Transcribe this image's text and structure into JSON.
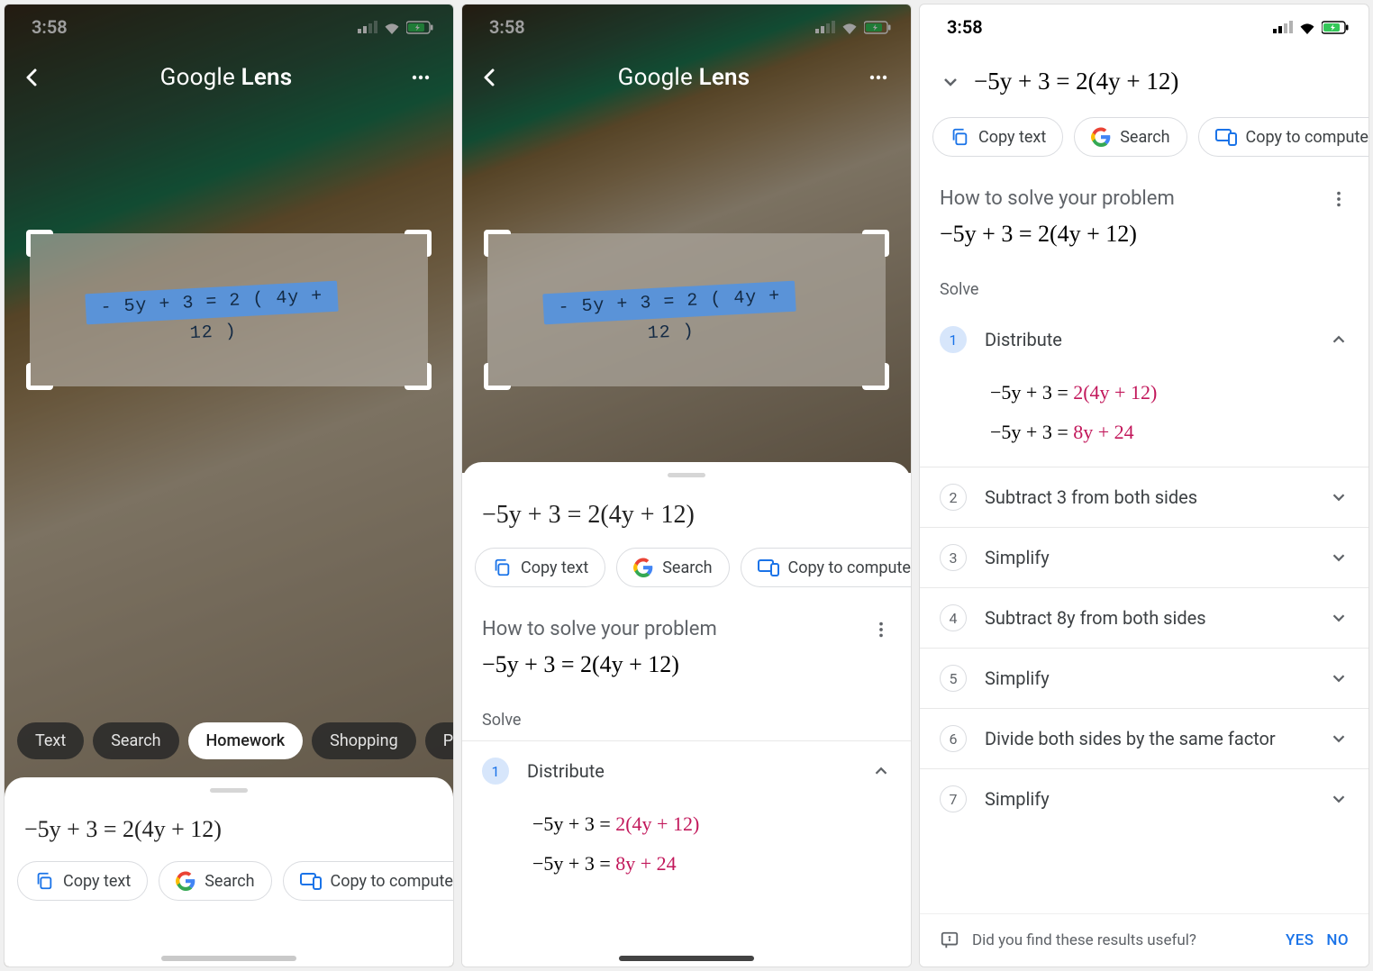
{
  "status": {
    "time": "3:58",
    "carrier_strength": 3
  },
  "lens": {
    "brand_light": "Google",
    "brand_bold": "Lens"
  },
  "handwritten_eq": "- 5y + 3 = 2 ( 4y + 12 )",
  "categories": [
    "Text",
    "Search",
    "Homework",
    "Shopping",
    "Places"
  ],
  "equation": "−5y + 3 = 2(4y + 12)",
  "actions": {
    "copy_text": "Copy text",
    "search": "Search",
    "copy_to_computer": "Copy to computer"
  },
  "solve": {
    "heading": "How to solve your problem",
    "label": "Solve",
    "steps": [
      {
        "n": 1,
        "title": "Distribute",
        "expanded": true,
        "lines": [
          {
            "lhs": "−5y + 3 = ",
            "rhs": "2(4y + 12)"
          },
          {
            "lhs": "−5y + 3 = ",
            "rhs": "8y + 24"
          }
        ]
      },
      {
        "n": 2,
        "title": "Subtract 3 from both sides",
        "expanded": false
      },
      {
        "n": 3,
        "title": "Simplify",
        "expanded": false
      },
      {
        "n": 4,
        "title": "Subtract 8y from both sides",
        "expanded": false
      },
      {
        "n": 5,
        "title": "Simplify",
        "expanded": false
      },
      {
        "n": 6,
        "title": "Divide both sides by the same factor",
        "expanded": false
      },
      {
        "n": 7,
        "title": "Simplify",
        "expanded": false
      }
    ]
  },
  "feedback": {
    "prompt": "Did you find these results useful?",
    "yes": "YES",
    "no": "NO"
  }
}
